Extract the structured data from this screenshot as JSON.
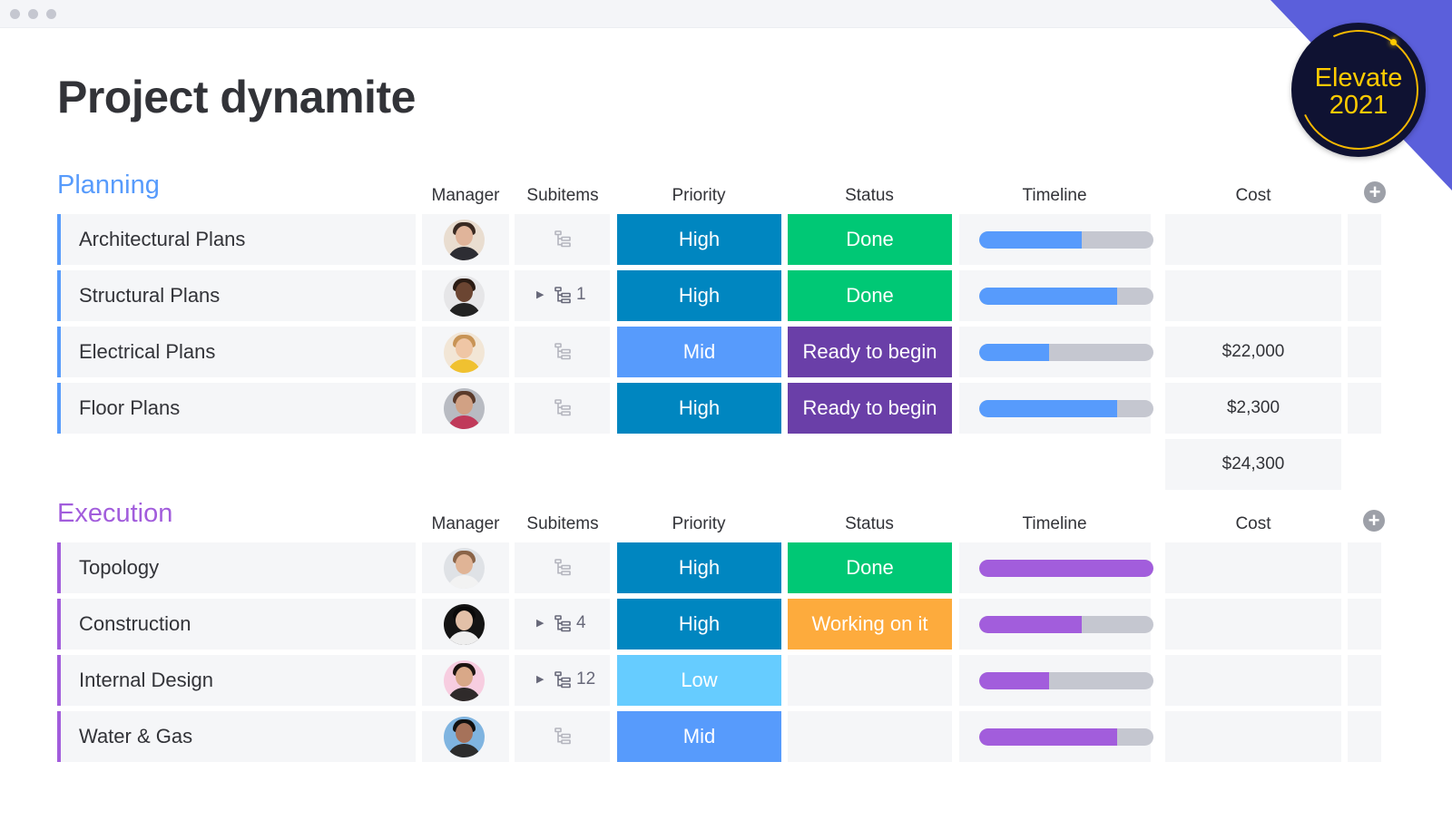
{
  "window": {
    "controls": [
      "close",
      "minimize",
      "maximize"
    ]
  },
  "badge": {
    "line1": "Elevate",
    "line2": "2021"
  },
  "page_title": "Project dynamite",
  "columns": {
    "manager": "Manager",
    "subitems": "Subitems",
    "priority": "Priority",
    "status": "Status",
    "timeline": "Timeline",
    "cost": "Cost",
    "add_column_icon": "plus-circle-icon"
  },
  "colors": {
    "planning": "#579bfc",
    "execution": "#a25ddc",
    "priority_high": "#0086c0",
    "priority_mid": "#579bfc",
    "priority_low": "#66ccff",
    "status_done": "#00c875",
    "status_ready": "#6a3fa8",
    "status_working": "#fdab3d",
    "timeline_track": "#c5c7d0"
  },
  "groups": [
    {
      "title": "Planning",
      "color_key": "planning",
      "rows": [
        {
          "name": "Architectural Plans",
          "manager": "woman-dark-hair",
          "subitems_count": "",
          "priority": "High",
          "priority_color": "#0086c0",
          "status": "Done",
          "status_color": "#00c875",
          "timeline_progress": 0.59,
          "cost": ""
        },
        {
          "name": "Structural Plans",
          "manager": "man-bald",
          "subitems_count": "1",
          "priority": "High",
          "priority_color": "#0086c0",
          "status": "Done",
          "status_color": "#00c875",
          "timeline_progress": 0.79,
          "cost": ""
        },
        {
          "name": "Electrical Plans",
          "manager": "woman-blonde",
          "subitems_count": "",
          "priority": "Mid",
          "priority_color": "#579bfc",
          "status": "Ready to begin",
          "status_color": "#6a3fa8",
          "timeline_progress": 0.4,
          "cost": "$22,000"
        },
        {
          "name": "Floor Plans",
          "manager": "man-beard",
          "subitems_count": "",
          "priority": "High",
          "priority_color": "#0086c0",
          "status": "Ready to begin",
          "status_color": "#6a3fa8",
          "timeline_progress": 0.79,
          "cost": "$2,300"
        }
      ],
      "cost_sum": "$24,300"
    },
    {
      "title": "Execution",
      "color_key": "execution",
      "rows": [
        {
          "name": "Topology",
          "manager": "man-short-hair",
          "subitems_count": "",
          "priority": "High",
          "priority_color": "#0086c0",
          "status": "Done",
          "status_color": "#00c875",
          "timeline_progress": 1.0,
          "cost": ""
        },
        {
          "name": "Construction",
          "manager": "man-dark-curly",
          "subitems_count": "4",
          "priority": "High",
          "priority_color": "#0086c0",
          "status": "Working on it",
          "status_color": "#fdab3d",
          "timeline_progress": 0.59,
          "cost": ""
        },
        {
          "name": "Internal Design",
          "manager": "woman-pink-bg",
          "subitems_count": "12",
          "priority": "Low",
          "priority_color": "#66ccff",
          "status": "",
          "status_color": "#f5f6f8",
          "timeline_progress": 0.4,
          "cost": ""
        },
        {
          "name": "Water & Gas",
          "manager": "man-sunglasses",
          "subitems_count": "",
          "priority": "Mid",
          "priority_color": "#579bfc",
          "status": "",
          "status_color": "#f5f6f8",
          "timeline_progress": 0.79,
          "cost": ""
        }
      ]
    }
  ]
}
